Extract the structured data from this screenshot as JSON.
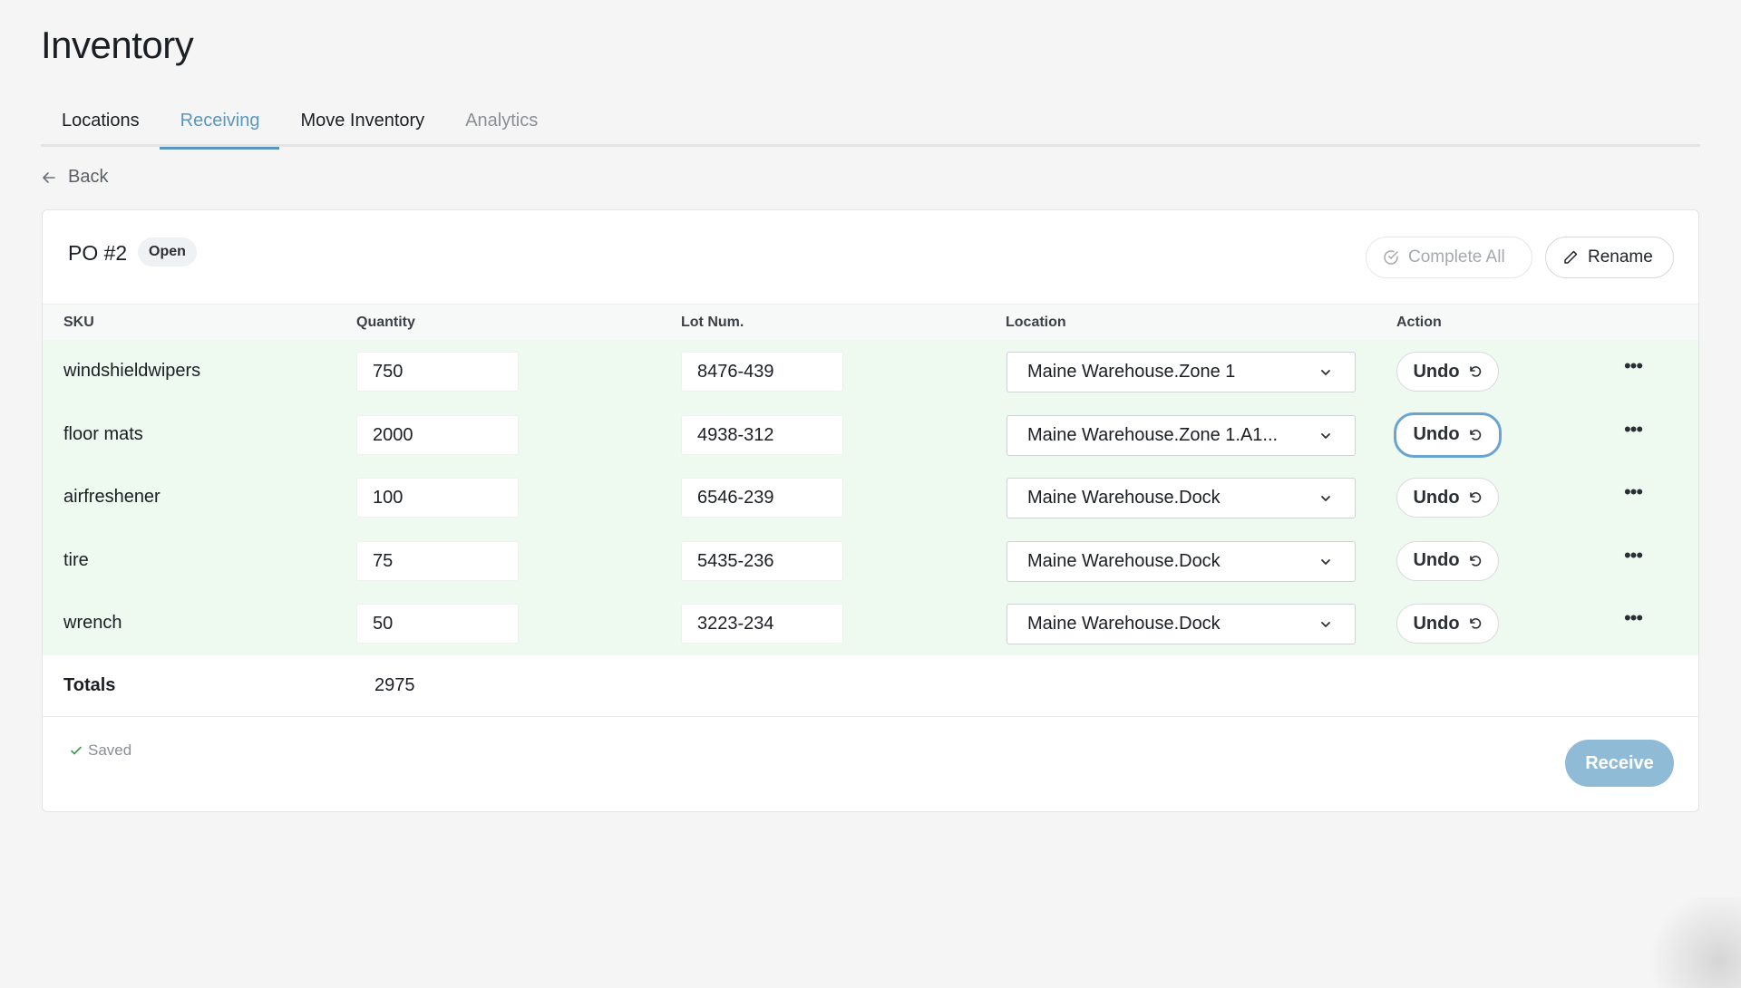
{
  "page": {
    "title": "Inventory"
  },
  "tabs": [
    {
      "label": "Locations"
    },
    {
      "label": "Receiving"
    },
    {
      "label": "Move Inventory"
    },
    {
      "label": "Analytics"
    }
  ],
  "back": {
    "label": "Back"
  },
  "po": {
    "title": "PO #2",
    "status": "Open",
    "complete_all_label": "Complete All",
    "rename_label": "Rename"
  },
  "table": {
    "headers": {
      "sku": "SKU",
      "quantity": "Quantity",
      "lot": "Lot Num.",
      "location": "Location",
      "action": "Action"
    },
    "undo_label": "Undo",
    "rows": [
      {
        "sku": "windshieldwipers",
        "quantity": "750",
        "lot": "8476-439",
        "location": "Maine Warehouse.Zone 1"
      },
      {
        "sku": "floor mats",
        "quantity": "2000",
        "lot": "4938-312",
        "location": "Maine Warehouse.Zone 1.A1..."
      },
      {
        "sku": "airfreshener",
        "quantity": "100",
        "lot": "6546-239",
        "location": "Maine Warehouse.Dock"
      },
      {
        "sku": "tire",
        "quantity": "75",
        "lot": "5435-236",
        "location": "Maine Warehouse.Dock"
      },
      {
        "sku": "wrench",
        "quantity": "50",
        "lot": "3223-234",
        "location": "Maine Warehouse.Dock"
      }
    ],
    "totals_label": "Totals",
    "totals_value": "2975"
  },
  "footer": {
    "saved_label": "Saved",
    "receive_label": "Receive"
  },
  "colors": {
    "accent": "#5b97bd",
    "row_bg": "#eef9f0",
    "receive_bg": "#8fbbd6"
  }
}
